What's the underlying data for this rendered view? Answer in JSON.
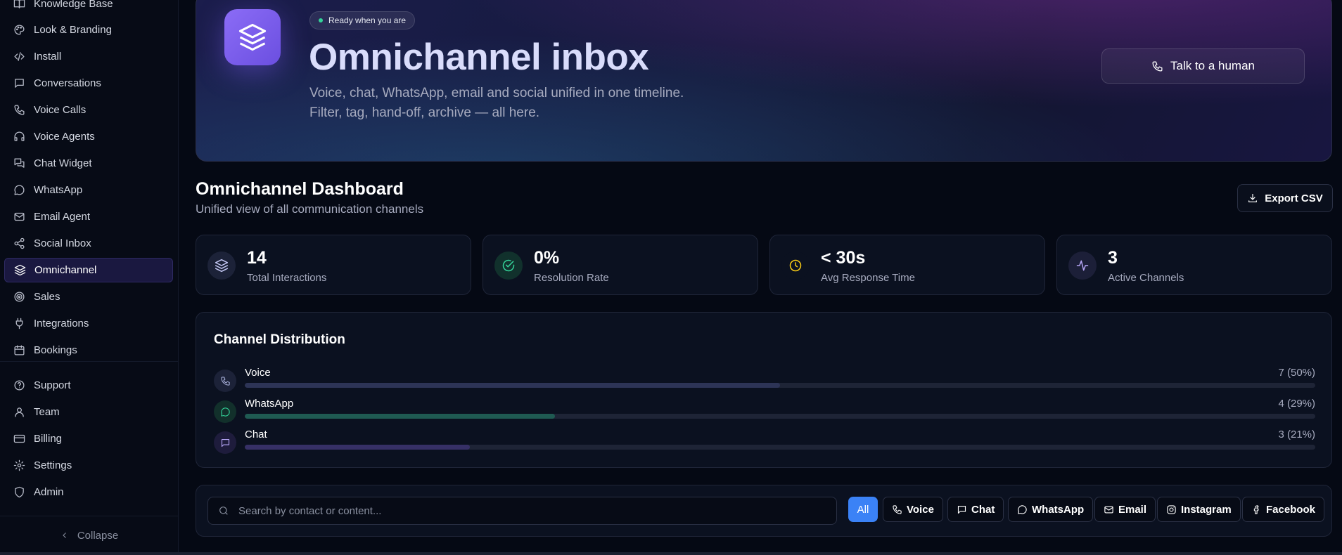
{
  "sidebar": {
    "items": [
      {
        "label": "Knowledge Base",
        "icon": "book-icon"
      },
      {
        "label": "Look & Branding",
        "icon": "palette-icon"
      },
      {
        "label": "Install",
        "icon": "code-icon"
      },
      {
        "label": "Conversations",
        "icon": "message-square-icon"
      },
      {
        "label": "Voice Calls",
        "icon": "phone-icon"
      },
      {
        "label": "Voice Agents",
        "icon": "headphones-icon"
      },
      {
        "label": "Chat Widget",
        "icon": "chat-widget-icon"
      },
      {
        "label": "WhatsApp",
        "icon": "message-circle-icon"
      },
      {
        "label": "Email Agent",
        "icon": "mail-icon"
      },
      {
        "label": "Social Inbox",
        "icon": "share-icon"
      },
      {
        "label": "Omnichannel",
        "icon": "layers-icon",
        "active": true
      },
      {
        "label": "Sales",
        "icon": "target-icon"
      },
      {
        "label": "Integrations",
        "icon": "plug-icon"
      },
      {
        "label": "Bookings",
        "icon": "calendar-icon"
      }
    ],
    "bottom_items": [
      {
        "label": "Support",
        "icon": "help-circle-icon"
      },
      {
        "label": "Team",
        "icon": "user-icon"
      },
      {
        "label": "Billing",
        "icon": "credit-card-icon"
      },
      {
        "label": "Settings",
        "icon": "gear-icon"
      },
      {
        "label": "Admin",
        "icon": "shield-icon"
      }
    ],
    "collapse_label": "Collapse"
  },
  "hero": {
    "badge": "Ready when you are",
    "title": "Omnichannel inbox",
    "subtitle_line1": "Voice, chat, WhatsApp, email and social unified in one timeline.",
    "subtitle_line2": "Filter, tag, hand-off, archive — all here.",
    "cta_label": "Talk to a human"
  },
  "dashboard": {
    "title": "Omnichannel Dashboard",
    "subtitle": "Unified view of all communication channels",
    "export_label": "Export CSV"
  },
  "stats": [
    {
      "value": "14",
      "label": "Total Interactions",
      "icon": "layers-icon",
      "color": "#a78bfa"
    },
    {
      "value": "0%",
      "label": "Resolution Rate",
      "icon": "check-circle-icon",
      "color": "#34d399"
    },
    {
      "value": "< 30s",
      "label": "Avg Response Time",
      "icon": "clock-icon",
      "color": "#facc15"
    },
    {
      "value": "3",
      "label": "Active Channels",
      "icon": "activity-icon",
      "color": "#a78bfa"
    }
  ],
  "distribution": {
    "title": "Channel Distribution",
    "rows": [
      {
        "name": "Voice",
        "count_text": "7 (50%)",
        "fraction": 0.5,
        "color": "#2d3456",
        "icon": "phone-icon"
      },
      {
        "name": "WhatsApp",
        "count_text": "4 (29%)",
        "fraction": 0.29,
        "color": "#1f5a52",
        "icon": "message-circle-icon"
      },
      {
        "name": "Chat",
        "count_text": "3 (21%)",
        "fraction": 0.21,
        "color": "#363066",
        "icon": "message-square-icon"
      }
    ]
  },
  "filters": {
    "search_placeholder": "Search by contact or content...",
    "chips": [
      {
        "label": "All",
        "active": true
      },
      {
        "label": "Voice",
        "icon": "phone-icon"
      },
      {
        "label": "Chat",
        "icon": "message-square-icon"
      },
      {
        "label": "WhatsApp",
        "icon": "message-circle-icon"
      },
      {
        "label": "Email",
        "icon": "mail-icon"
      },
      {
        "label": "Instagram",
        "icon": "instagram-icon"
      },
      {
        "label": "Facebook",
        "icon": "facebook-icon"
      }
    ]
  }
}
